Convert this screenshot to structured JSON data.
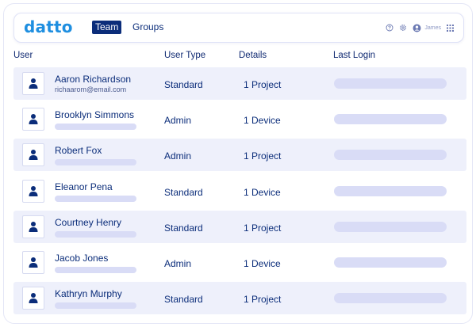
{
  "app": {
    "logo": "datto"
  },
  "nav": {
    "tabs": [
      {
        "label": "Team",
        "active": true
      },
      {
        "label": "Groups",
        "active": false
      }
    ]
  },
  "topbar": {
    "icons": [
      "help-icon",
      "settings-icon",
      "user-icon",
      "apps-grid-icon"
    ],
    "username": "James"
  },
  "table": {
    "headers": {
      "user": "User",
      "user_type": "User Type",
      "details": "Details",
      "last_login": "Last Login"
    },
    "rows": [
      {
        "name": "Aaron Richardson",
        "email": "richaarom@email.com",
        "user_type": "Standard",
        "details": "1 Project"
      },
      {
        "name": "Brooklyn Simmons",
        "email": "",
        "user_type": "Admin",
        "details": "1 Device"
      },
      {
        "name": "Robert Fox",
        "email": "",
        "user_type": "Admin",
        "details": "1 Project"
      },
      {
        "name": "Eleanor Pena",
        "email": "",
        "user_type": "Standard",
        "details": "1 Device"
      },
      {
        "name": "Courtney Henry",
        "email": "",
        "user_type": "Standard",
        "details": "1 Project"
      },
      {
        "name": "Jacob Jones",
        "email": "",
        "user_type": "Admin",
        "details": "1 Device"
      },
      {
        "name": "Kathryn Murphy",
        "email": "",
        "user_type": "Standard",
        "details": "1 Project"
      }
    ]
  },
  "colors": {
    "brand": "#1f8fe0",
    "navy": "#0b2d7a",
    "row_shade": "#eef0fb",
    "placeholder": "#d9dcf6"
  }
}
